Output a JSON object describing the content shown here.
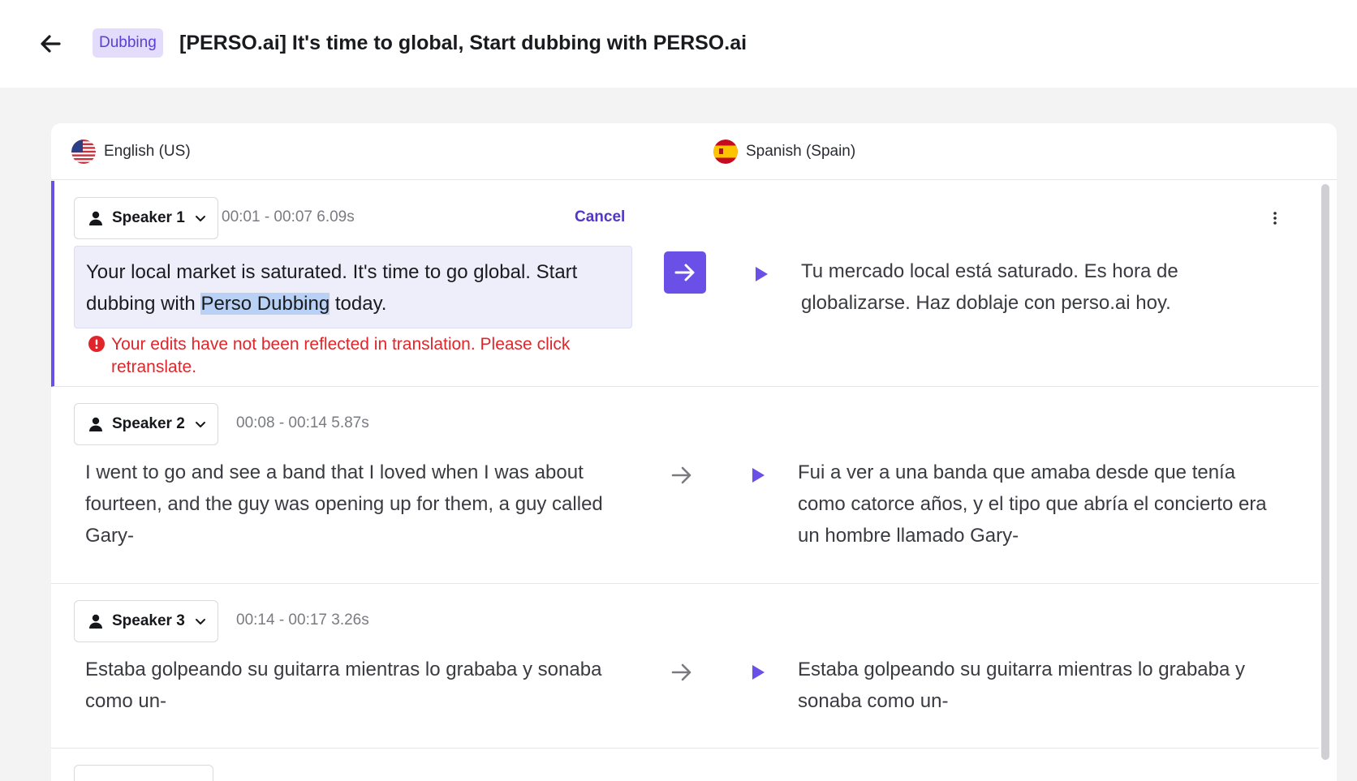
{
  "header": {
    "badge": "Dubbing",
    "title": "[PERSO.ai] It's time to global, Start dubbing with PERSO.ai"
  },
  "languages": {
    "source": "English (US)",
    "target": "Spanish (Spain)"
  },
  "segments": [
    {
      "speaker": "Speaker 1",
      "timing": "00:01 - 00:07 6.09s",
      "cancel_label": "Cancel",
      "source_before": "Your local market is saturated. It's time to go global. Start dubbing with ",
      "source_highlight": "Perso Dubbing",
      "source_after": " today.",
      "error": "Your edits have not been reflected in translation. Please click retranslate.",
      "target": "Tu mercado local está saturado. Es hora de globalizarse. Haz doblaje con perso.ai hoy."
    },
    {
      "speaker": "Speaker 2",
      "timing": "00:08 - 00:14 5.87s",
      "source": "I went to go and see a band that I loved when I was about fourteen, and the guy was opening up for them, a guy called Gary-",
      "target": "Fui a ver a una banda que amaba desde que tenía como catorce años, y el tipo que abría el concierto era un hombre llamado Gary-"
    },
    {
      "speaker": "Speaker 3",
      "timing": "00:14 - 00:17 3.26s",
      "source": "Estaba golpeando su guitarra mientras lo grababa y sonaba como un-",
      "target": "Estaba golpeando su guitarra mientras lo grababa y sonaba como un-"
    }
  ],
  "colors": {
    "accent": "#6a50e6",
    "error": "#e0262b",
    "badge_bg": "#e3dcfb"
  }
}
